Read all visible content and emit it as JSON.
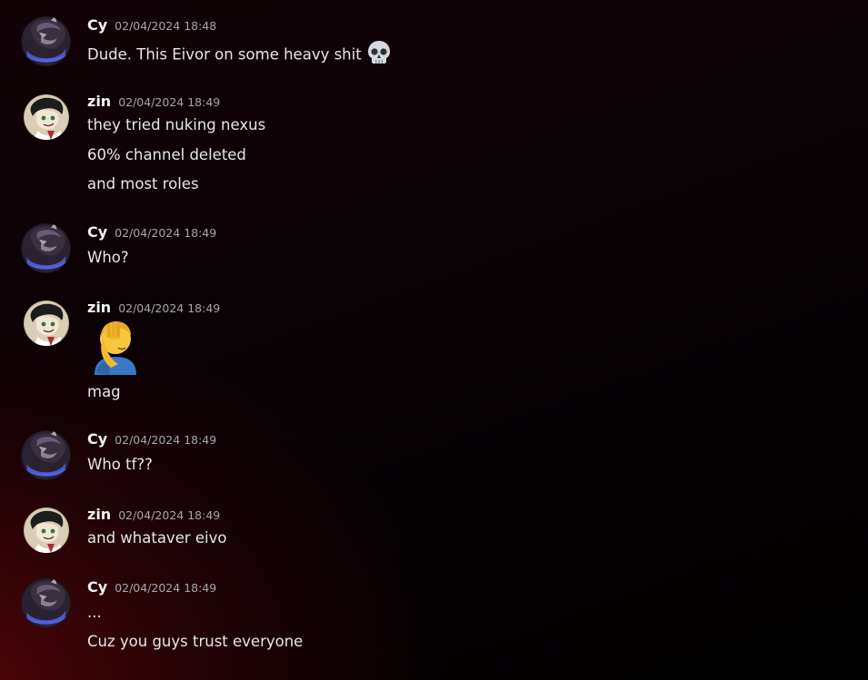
{
  "messages": [
    {
      "user": "Cy",
      "time": "02/04/2024 18:48",
      "lines": [
        "Dude. This Eivor on some heavy shit"
      ],
      "emoji": "skull-emoji"
    },
    {
      "user": "zin",
      "time": "02/04/2024 18:49",
      "lines": [
        "they tried nuking nexus",
        "60% channel deleted",
        "and most roles"
      ]
    },
    {
      "user": "Cy",
      "time": "02/04/2024 18:49",
      "lines": [
        "Who?"
      ]
    },
    {
      "user": "zin",
      "time": "02/04/2024 18:49",
      "emoji": "facepalm-emoji",
      "lines": [
        "mag"
      ]
    },
    {
      "user": "Cy",
      "time": "02/04/2024 18:49",
      "lines": [
        "Who tf??"
      ]
    },
    {
      "user": "zin",
      "time": "02/04/2024 18:49",
      "lines": [
        "and whataver eivo"
      ]
    },
    {
      "user": "Cy",
      "time": "02/04/2024 18:49",
      "lines": [
        "...",
        "Cuz you guys trust everyone"
      ]
    }
  ],
  "colors": {
    "username": "#f2f3f5",
    "timestamp": "#a3a6ad",
    "text": "#e6e6ea",
    "background": "#0b0205"
  }
}
